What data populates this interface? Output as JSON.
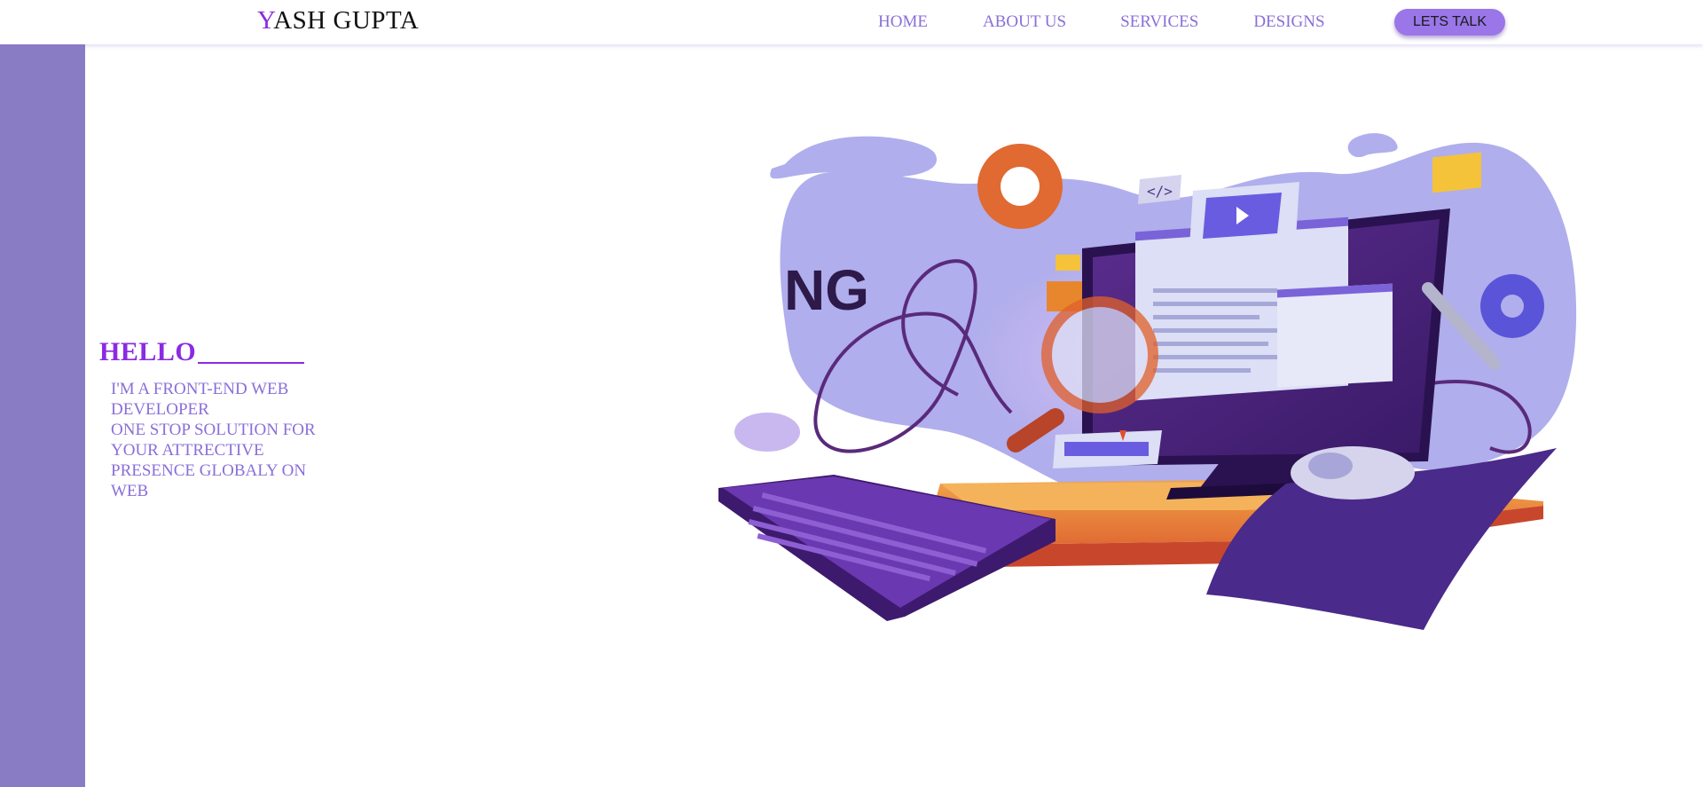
{
  "header": {
    "brand_first_letter": "Y",
    "brand_rest": "ASH GUPTA",
    "nav": [
      {
        "label": "HOME"
      },
      {
        "label": "ABOUT US"
      },
      {
        "label": "SERVICES"
      },
      {
        "label": "DESIGNS"
      }
    ],
    "cta_label": "LETS TALK"
  },
  "hero": {
    "greeting": "HELLO",
    "intro_line1": "I'M A FRONT-END WEB DEVELOPER",
    "intro_line2": "ONE STOP SOLUTION FOR YOUR ATTRECTIVE PRESENCE GLOBALY ON WEB"
  },
  "illustration": {
    "partial_text": "NG",
    "icons": [
      "gear-icon",
      "code-icon",
      "play-icon",
      "wrench-icon",
      "magnifier-icon"
    ]
  },
  "colors": {
    "accent": "#8a2be2",
    "nav_text": "#8a6fd8",
    "sidebar": "#8a7cc4",
    "cta_bg": "#9a76e8",
    "blob": "#b0aeec"
  }
}
